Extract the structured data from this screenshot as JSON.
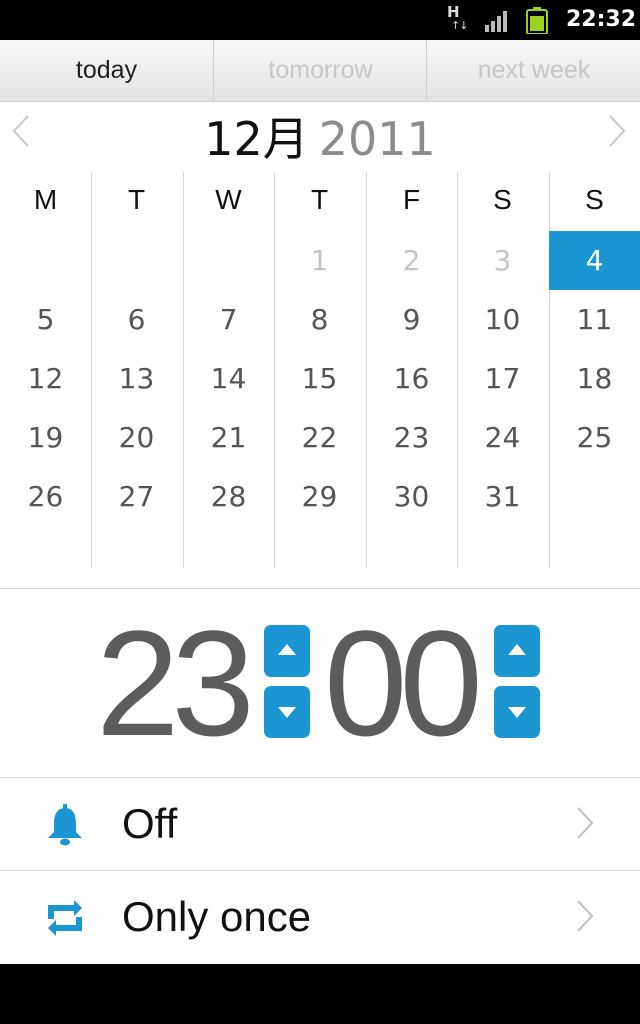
{
  "status_bar": {
    "network_letter": "H",
    "network_arrows": "↑↓",
    "time": "22:32",
    "signal_icon": "signal-bars-icon",
    "battery_icon": "battery-icon",
    "battery_color": "#9bd21e"
  },
  "tabs": [
    {
      "label": "today",
      "active": true
    },
    {
      "label": "tomorrow",
      "active": false
    },
    {
      "label": "next week",
      "active": false
    }
  ],
  "calendar": {
    "month": "12月",
    "year": "2011",
    "weekdays": [
      "M",
      "T",
      "W",
      "T",
      "F",
      "S",
      "S"
    ],
    "weeks": [
      [
        "",
        "",
        "",
        "1",
        "2",
        "3",
        "4"
      ],
      [
        "5",
        "6",
        "7",
        "8",
        "9",
        "10",
        "11"
      ],
      [
        "12",
        "13",
        "14",
        "15",
        "16",
        "17",
        "18"
      ],
      [
        "19",
        "20",
        "21",
        "22",
        "23",
        "24",
        "25"
      ],
      [
        "26",
        "27",
        "28",
        "29",
        "30",
        "31",
        ""
      ]
    ],
    "muted_days": [
      "1",
      "2",
      "3"
    ],
    "selected_day": "4",
    "accent_color": "#1c96d3"
  },
  "time": {
    "hour": "23",
    "minute": "00"
  },
  "settings": [
    {
      "label": "Off",
      "icon": "bell-icon"
    },
    {
      "label": "Only once",
      "icon": "repeat-icon"
    }
  ]
}
